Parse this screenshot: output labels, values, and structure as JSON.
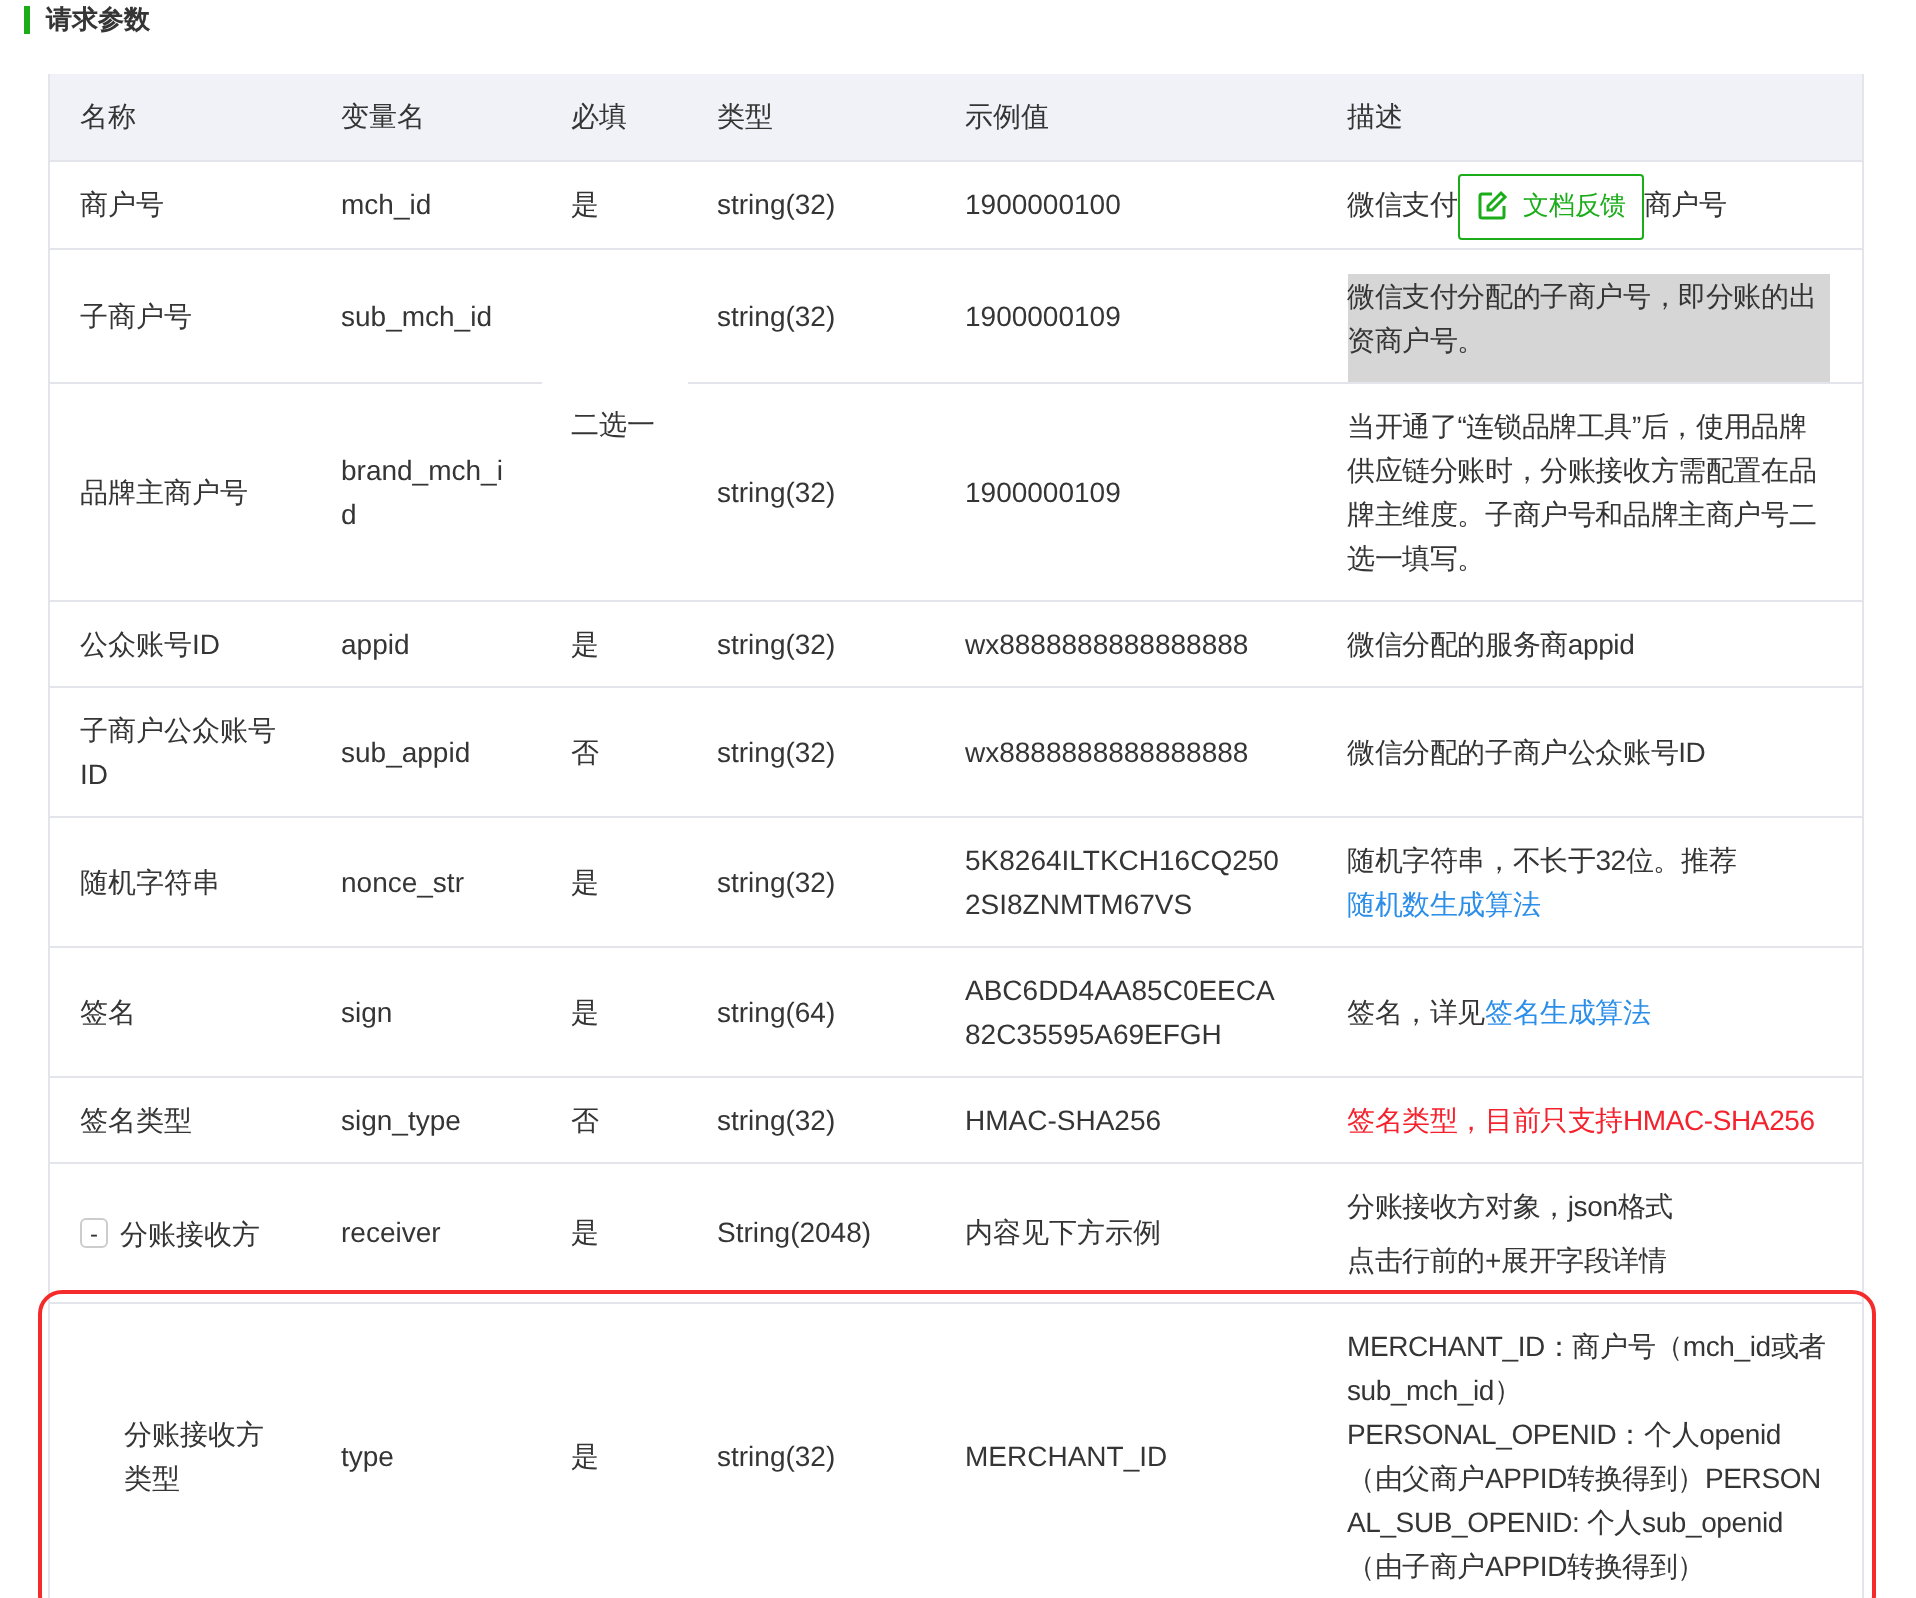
{
  "section_title": "请求参数",
  "columns": [
    "名称",
    "变量名",
    "必填",
    "类型",
    "示例值",
    "描述"
  ],
  "rows": [
    {
      "name": "商户号",
      "var": "mch_id",
      "required": "是",
      "type": "string(32)",
      "example": "1900000100",
      "description": [
        [
          {
            "kind": "plain",
            "text": "微信支付"
          },
          {
            "kind": "tooltip",
            "text": "文档反馈"
          },
          {
            "kind": "plain",
            "text": "商户号"
          }
        ]
      ]
    },
    {
      "name": "子商户号",
      "var": "sub_mch_id",
      "required": "二选一",
      "required_merged_with_next": true,
      "type": "string(32)",
      "example": "1900000109",
      "highlighted": true,
      "description": [
        [
          {
            "kind": "plain",
            "text": "微信支付分配的子商户号，即分账的出资商户号。"
          }
        ]
      ]
    },
    {
      "name": "品牌主商户号",
      "var": "brand_mch_id",
      "type": "string(32)",
      "example": "1900000109",
      "description": [
        [
          {
            "kind": "plain",
            "text": "当开通了“连锁品牌工具”后，使用品牌供应链分账时，分账接收方需配置在品牌主维度。子商户号和品牌主商户号二选一填写。"
          }
        ]
      ]
    },
    {
      "name": "公众账号ID",
      "var": "appid",
      "required": "是",
      "type": "string(32)",
      "example": "wx8888888888888888",
      "description": [
        [
          {
            "kind": "plain",
            "text": "微信分配的服务商appid"
          }
        ]
      ]
    },
    {
      "name": "子商户公众账号ID",
      "var": "sub_appid",
      "required": "否",
      "type": "string(32)",
      "example": "wx8888888888888888",
      "description": [
        [
          {
            "kind": "plain",
            "text": "微信分配的子商户公众账号ID"
          }
        ]
      ]
    },
    {
      "name": "随机字符串",
      "var": "nonce_str",
      "required": "是",
      "type": "string(32)",
      "example": "5K8264ILTKCH16CQ2502SI8ZNMTM67VS",
      "description": [
        [
          {
            "kind": "plain",
            "text": "随机字符串，不长于32位。推荐"
          },
          {
            "kind": "link",
            "text": "随机数生成算法"
          }
        ]
      ]
    },
    {
      "name": "签名",
      "var": "sign",
      "required": "是",
      "type": "string(64)",
      "example": "ABC6DD4AA85C0EECA82C35595A69EFGH",
      "description": [
        [
          {
            "kind": "plain",
            "text": "签名，详见"
          },
          {
            "kind": "link",
            "text": "签名生成算法"
          }
        ]
      ]
    },
    {
      "name": "签名类型",
      "var": "sign_type",
      "required": "否",
      "type": "string(32)",
      "example": "HMAC-SHA256",
      "description": [
        [
          {
            "kind": "warning",
            "text": "签名类型，目前只支持HMAC-SHA256"
          }
        ]
      ]
    },
    {
      "name": "分账接收方",
      "var": "receiver",
      "required": "是",
      "type": "String(2048)",
      "example": "内容见下方示例",
      "toggle": "-",
      "expanded": true,
      "description": [
        [
          {
            "kind": "plain",
            "text": "分账接收方对象，json格式"
          }
        ],
        [
          {
            "kind": "plain",
            "text": "点击行前的+展开字段详情"
          }
        ]
      ],
      "children": [
        {
          "name": "分账接收方类型",
          "var": "type",
          "required": "是",
          "type": "string(32)",
          "example": "MERCHANT_ID",
          "outlined": true,
          "description": [
            [
              {
                "kind": "plain",
                "text": "MERCHANT_ID：商户号（mch_id或者sub_mch_id）"
              }
            ],
            [
              {
                "kind": "plain",
                "text": "PERSONAL_OPENID：个人openid（由父商户APPID转换得到）PERSONAL_SUB_OPENID: 个人sub_openid（由子商户APPID转换得到）"
              }
            ]
          ]
        }
      ]
    }
  ]
}
